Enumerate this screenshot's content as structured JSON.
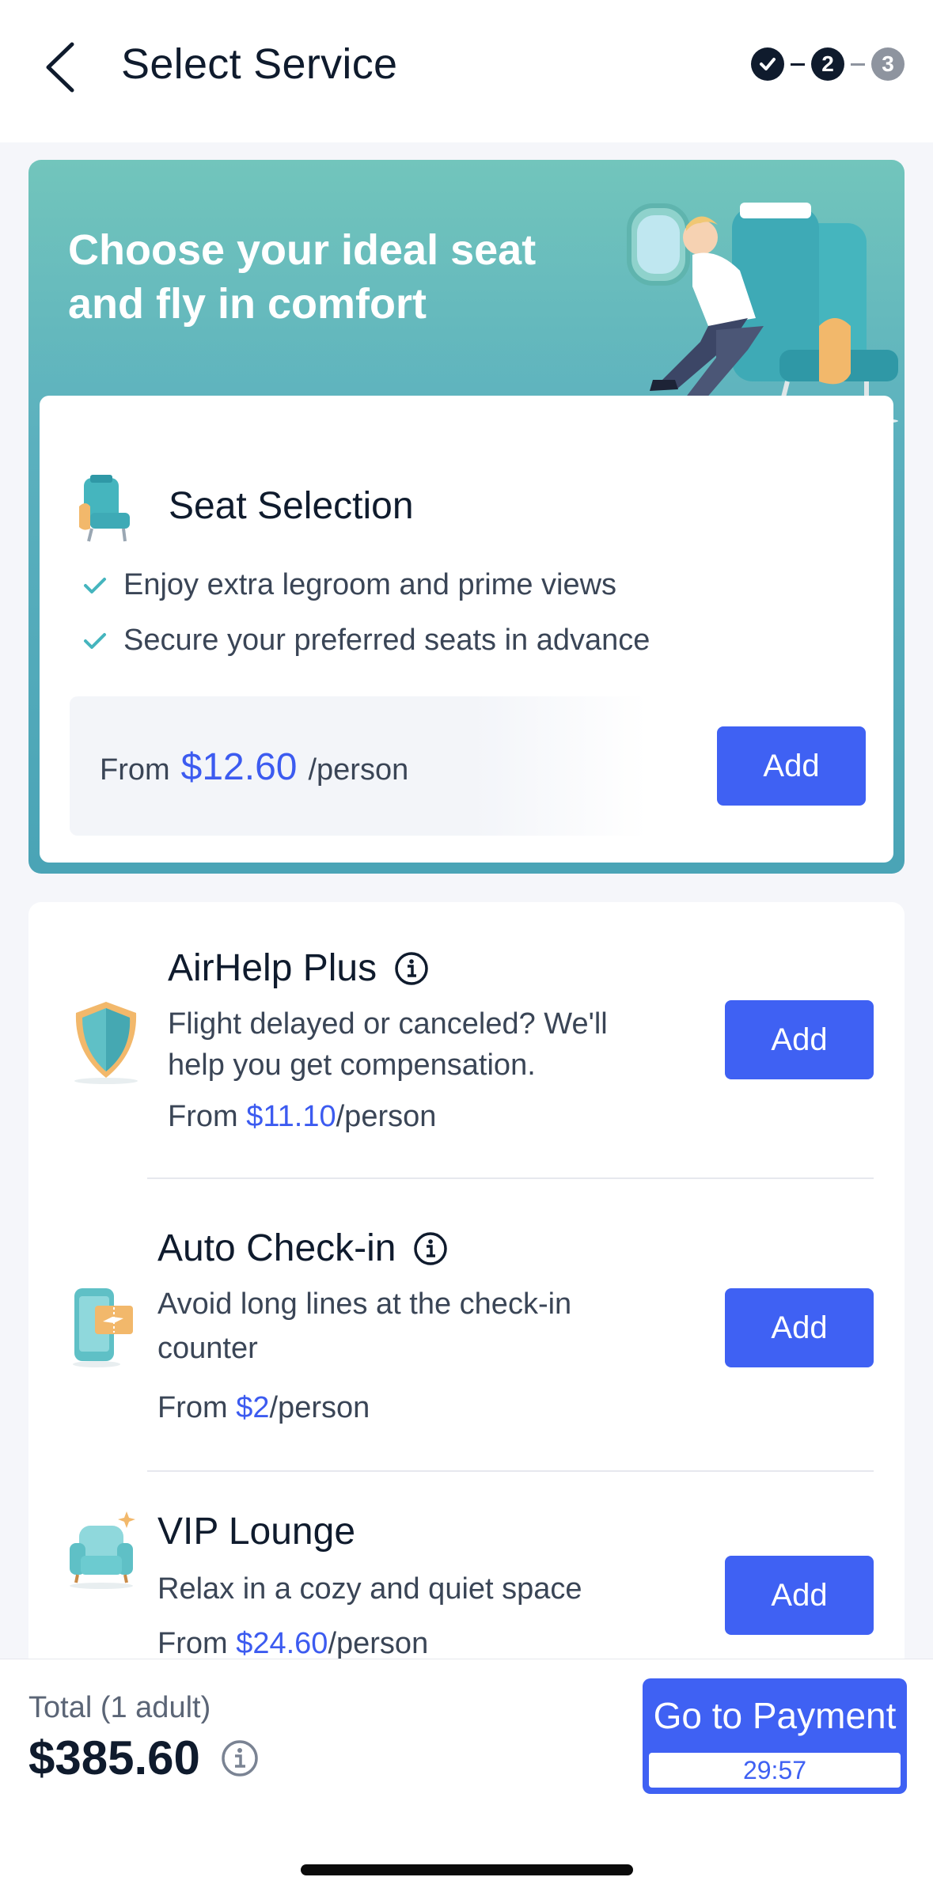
{
  "header": {
    "title": "Select Service",
    "steps": [
      "✓",
      "2",
      "3"
    ]
  },
  "hero": {
    "title_line1": "Choose your ideal seat",
    "title_line2": "and fly in comfort"
  },
  "seat_card": {
    "title": "Seat Selection",
    "features": [
      "Enjoy extra legroom and prime views",
      "Secure your preferred seats in advance"
    ],
    "price_prefix": "From",
    "price_amount": "$12.60",
    "price_suffix": "/person",
    "add_label": "Add"
  },
  "services": [
    {
      "title": "AirHelp Plus",
      "desc_line1": "Flight delayed or canceled? We'll",
      "desc_line2": "help you get compensation.",
      "price_prefix": "From ",
      "price_amount": "$11.10",
      "price_suffix": "/person",
      "add_label": "Add",
      "icon": "shield-icon"
    },
    {
      "title": "Auto Check-in",
      "desc_line1": "Avoid long lines at the check-in",
      "desc_line2": "counter",
      "price_prefix": "From ",
      "price_amount": "$2",
      "price_suffix": "/person",
      "add_label": "Add",
      "icon": "phone-ticket-icon"
    },
    {
      "title": "VIP Lounge",
      "desc_line1": "Relax in a cozy and quiet space",
      "price_prefix": "From ",
      "price_amount": "$24.60",
      "price_suffix": "/person",
      "add_label": "Add",
      "icon": "armchair-icon"
    }
  ],
  "bottom": {
    "total_label": "Total (1 adult)",
    "total_amount": "$385.60",
    "pay_label": "Go to Payment",
    "timer": "29:57"
  },
  "colors": {
    "accent": "#3f61f3",
    "price": "#3c5bf0",
    "teal": "#5bb0be"
  }
}
